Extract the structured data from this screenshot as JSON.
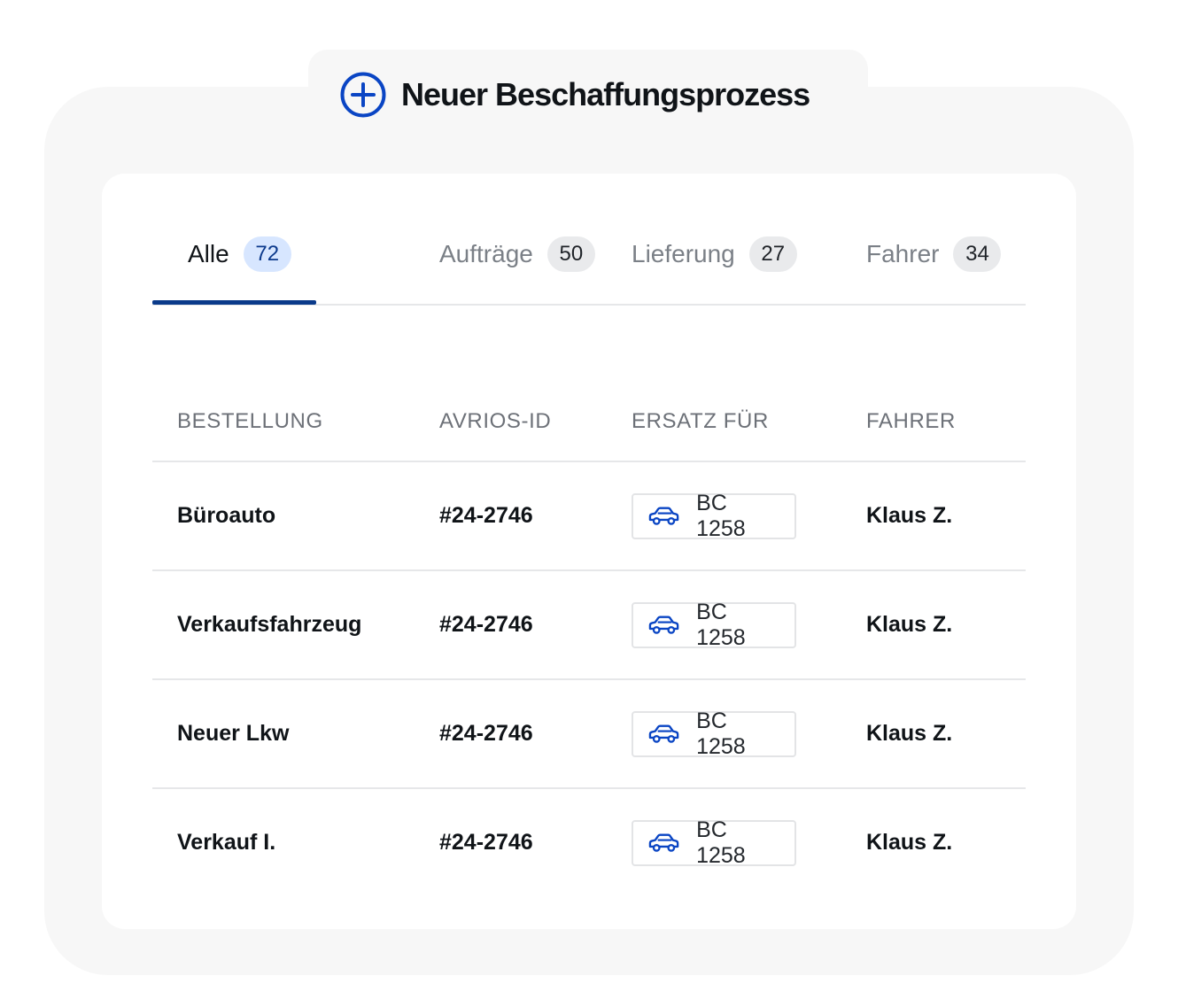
{
  "header": {
    "title": "Neuer Beschaffungsprozess",
    "icon": "plus-circle-icon",
    "accent": "#0a45c4"
  },
  "tabs": [
    {
      "label": "Alle",
      "count": "72",
      "active": true
    },
    {
      "label": "Aufträge",
      "count": "50",
      "active": false
    },
    {
      "label": "Lieferung",
      "count": "27",
      "active": false
    },
    {
      "label": "Fahrer",
      "count": "34",
      "active": false
    }
  ],
  "table": {
    "columns": [
      "BESTELLUNG",
      "AVRIOS-ID",
      "ERSATZ FÜR",
      "FAHRER"
    ],
    "rows": [
      {
        "bestellung": "Büroauto",
        "id": "#24-2746",
        "ersatz": "BC 1258",
        "fahrer": "Klaus Z."
      },
      {
        "bestellung": "Verkaufsfahrzeug",
        "id": "#24-2746",
        "ersatz": "BC 1258",
        "fahrer": "Klaus Z."
      },
      {
        "bestellung": "Neuer Lkw",
        "id": "#24-2746",
        "ersatz": "BC 1258",
        "fahrer": "Klaus Z."
      },
      {
        "bestellung": "Verkauf I.",
        "id": "#24-2746",
        "ersatz": "BC 1258",
        "fahrer": "Klaus Z."
      }
    ]
  },
  "colors": {
    "tab_active_underline": "#0a3a8a",
    "tab_active_badge_bg": "#d7e6ff",
    "car_icon": "#0a45c4"
  }
}
